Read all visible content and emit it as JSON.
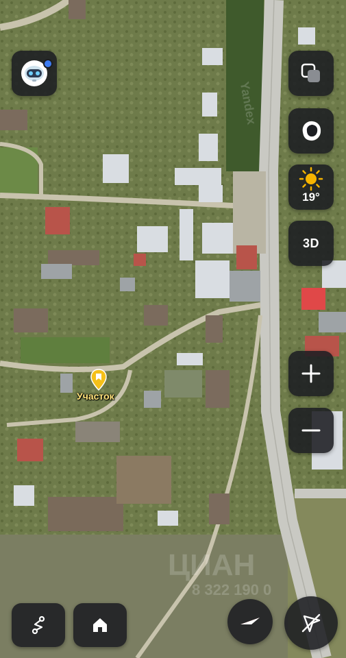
{
  "map": {
    "marker_label": "Участок",
    "provider_watermark": "Yandex",
    "listing_watermark": "ЦИАН",
    "phone_watermark": "8 322 190 0"
  },
  "weather": {
    "temperature": "19°",
    "icon": "sun-icon"
  },
  "controls": {
    "view_3d_label": "3D",
    "zoom_in_icon": "plus-icon",
    "zoom_out_icon": "minus-icon",
    "layers_icon": "layers-icon",
    "shape_icon": "blob-icon",
    "route_icon": "route-icon",
    "home_icon": "home-icon",
    "compass_icon": "compass-icon",
    "location_off_icon": "navigation-off-icon",
    "assistant_icon": "robot-assistant-icon"
  },
  "colors": {
    "control_bg": "#1c1e22",
    "marker": "#f5c019",
    "compass_red": "#e8463b",
    "badge": "#3d7cf2"
  }
}
